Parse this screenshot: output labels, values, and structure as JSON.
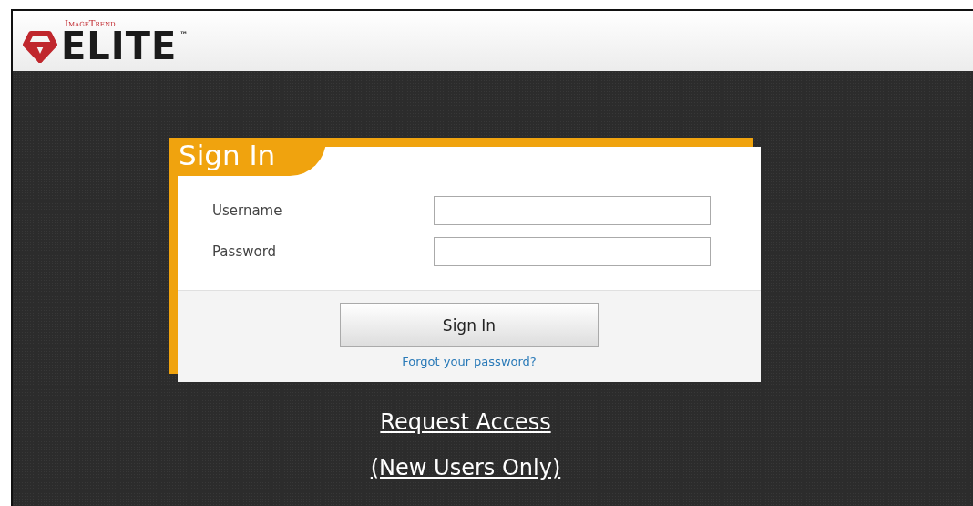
{
  "header": {
    "logo": {
      "brand": "ImageTrend",
      "product": "ELITE",
      "trademark": "™"
    }
  },
  "sign_in": {
    "title": "Sign In",
    "fields": [
      {
        "label": "Username"
      },
      {
        "label": "Password"
      }
    ],
    "button": "Sign In",
    "forgot_link": "Forgot your password?"
  },
  "request_access": {
    "link": "Request Access",
    "note": "(New Users Only)"
  }
}
